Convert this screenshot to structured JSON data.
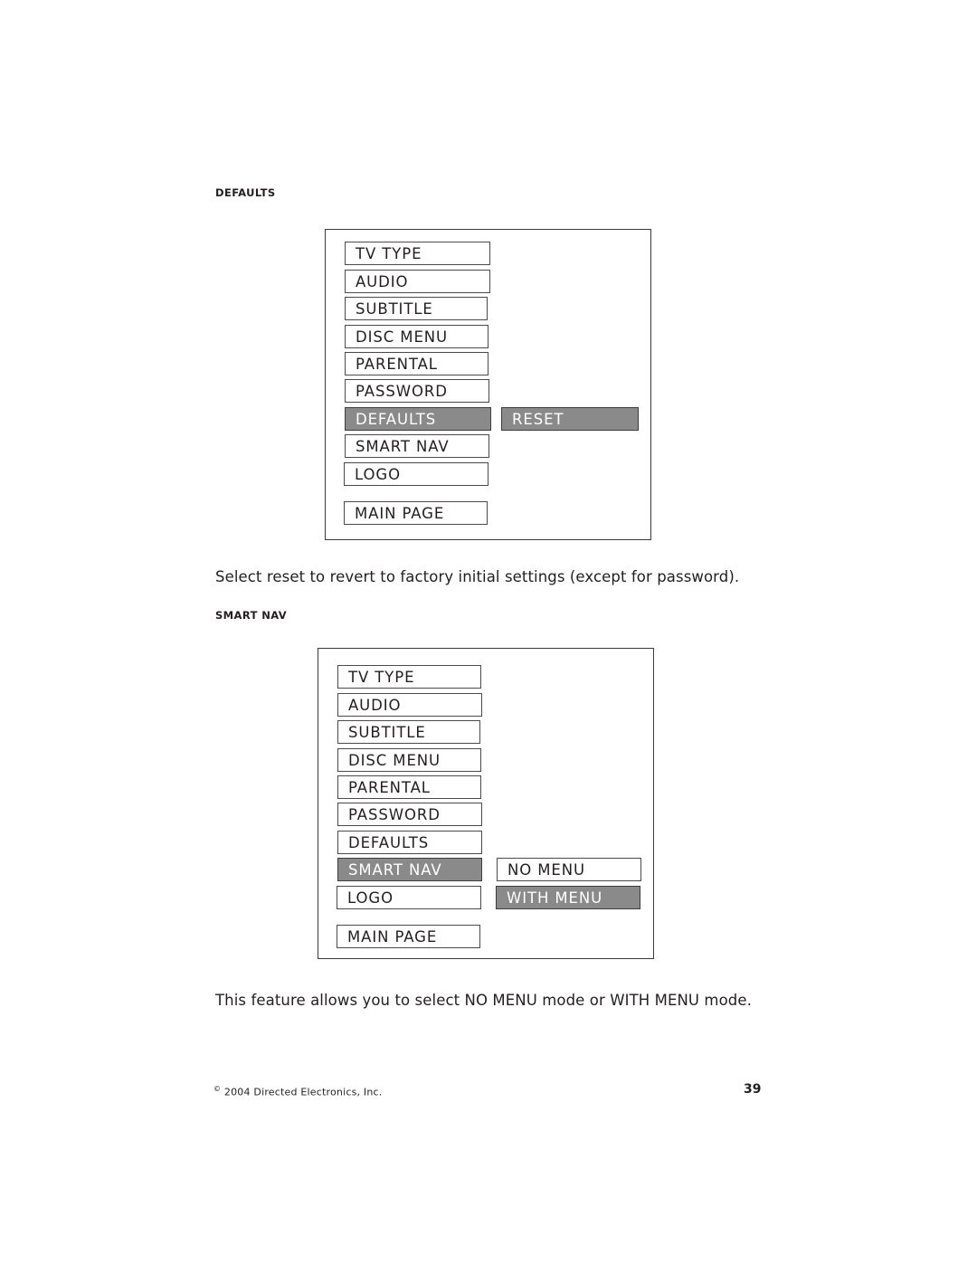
{
  "page": {
    "number": "39",
    "copyright_symbol": "©",
    "copyright_text": "2004  Directed Electronics, Inc."
  },
  "sections": [
    {
      "label": "DEFAULTS",
      "caption": "Select reset to revert to factory initial settings (except for password).",
      "menu": {
        "items": [
          {
            "label": "TV TYPE",
            "selected": false
          },
          {
            "label": "AUDIO",
            "selected": false
          },
          {
            "label": "SUBTITLE",
            "selected": false
          },
          {
            "label": "DISC MENU",
            "selected": false
          },
          {
            "label": "PARENTAL",
            "selected": false
          },
          {
            "label": "PASSWORD",
            "selected": false
          },
          {
            "label": "DEFAULTS",
            "selected": true
          },
          {
            "label": "SMART NAV",
            "selected": false
          },
          {
            "label": "LOGO",
            "selected": false
          },
          {
            "label": "MAIN PAGE",
            "selected": false
          }
        ],
        "submenu": [
          {
            "label": "RESET",
            "selected": true,
            "row": 6
          }
        ]
      }
    },
    {
      "label": "SMART NAV",
      "caption": "This feature allows you to select NO MENU mode or WITH MENU mode.",
      "menu": {
        "items": [
          {
            "label": "TV TYPE",
            "selected": false
          },
          {
            "label": "AUDIO",
            "selected": false
          },
          {
            "label": "SUBTITLE",
            "selected": false
          },
          {
            "label": "DISC MENU",
            "selected": false
          },
          {
            "label": "PARENTAL",
            "selected": false
          },
          {
            "label": "PASSWORD",
            "selected": false
          },
          {
            "label": "DEFAULTS",
            "selected": false
          },
          {
            "label": "SMART NAV",
            "selected": true
          },
          {
            "label": "LOGO",
            "selected": false
          },
          {
            "label": "MAIN PAGE",
            "selected": false
          }
        ],
        "submenu": [
          {
            "label": "NO MENU",
            "selected": false,
            "row": 7
          },
          {
            "label": "WITH MENU",
            "selected": true,
            "row": 8
          }
        ]
      }
    }
  ],
  "colors": {
    "selected_bg": "#8a8a8a",
    "border": "#4a4a4a",
    "text": "#231f20"
  }
}
